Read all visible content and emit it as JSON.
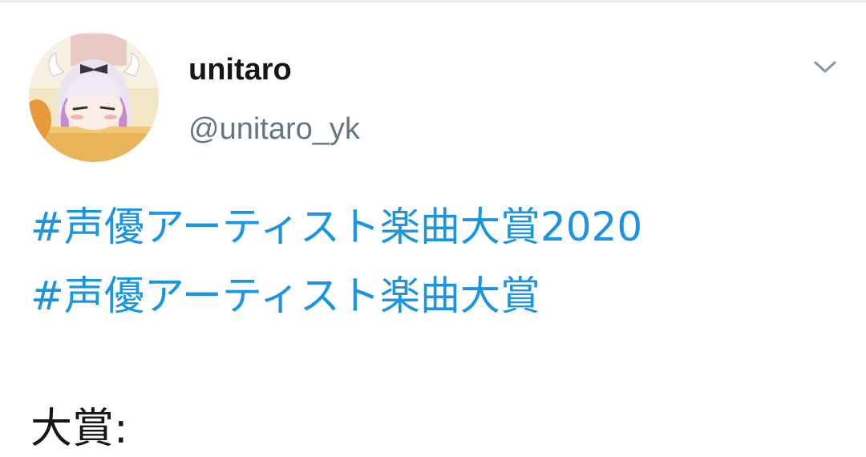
{
  "tweet": {
    "author": {
      "display_name": "unitaro",
      "handle": "@unitaro_yk",
      "avatar_icon": "anime-girl-avatar"
    },
    "menu_icon": "chevron-down-icon",
    "hashtags": [
      "#声優アーティスト楽曲大賞2020",
      "#声優アーティスト楽曲大賞"
    ],
    "body_line": "大賞:"
  },
  "colors": {
    "link": "#1b95e0",
    "text": "#14171a",
    "secondary": "#657786",
    "divider": "#e6ecf0"
  }
}
